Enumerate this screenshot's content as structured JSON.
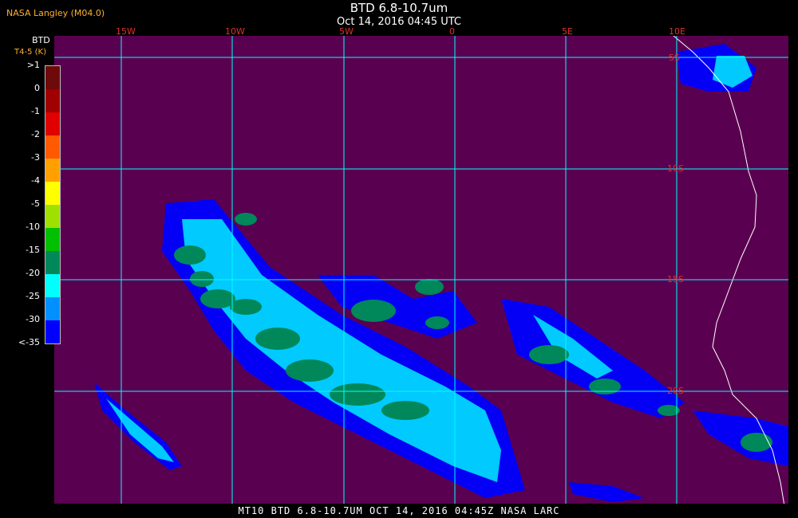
{
  "header": {
    "credit": "NASA Langley (M04.0)",
    "title": "BTD 6.8-10.7um",
    "subtitle": "Oct 14, 2016 04:45 UTC"
  },
  "legend": {
    "title": "BTD",
    "unit": "T4-5 (K)",
    "ticks": [
      ">1",
      "0",
      "-1",
      "-2",
      "-3",
      "-4",
      "-5",
      "-10",
      "-15",
      "-20",
      "-25",
      "-30",
      "<-35"
    ],
    "colors": [
      "#6e0a0a",
      "#a00000",
      "#e00000",
      "#ff5a00",
      "#ffa000",
      "#ffff00",
      "#a0e000",
      "#00c000",
      "#00885a",
      "#00ffff",
      "#0090ff",
      "#0000ff",
      "#5a0050"
    ]
  },
  "map": {
    "background": "#5a0050",
    "grid_color": "#00ffff",
    "lon_labels": [
      "15W",
      "10W",
      "5W",
      "0",
      "5E",
      "10E"
    ],
    "lat_labels": [
      "5S",
      "10S",
      "15S",
      "20S"
    ]
  },
  "footer": "MT10  BTD 6.8-10.7UM  OCT 14, 2016 04:45Z  NASA LARC"
}
